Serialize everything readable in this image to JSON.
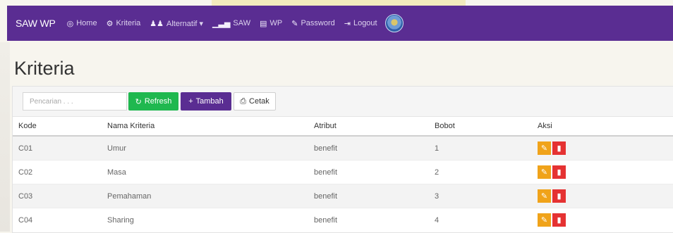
{
  "navbar": {
    "brand": "SAW WP",
    "items": [
      {
        "label": "Home",
        "icon": "dashboard-icon",
        "glyph": "◎"
      },
      {
        "label": "Kriteria",
        "icon": "gear-icon",
        "glyph": "⚙"
      },
      {
        "label": "Alternatif ▾",
        "icon": "users-icon",
        "glyph": "👥"
      },
      {
        "label": "SAW",
        "icon": "signal-icon",
        "glyph": "▁▃▅"
      },
      {
        "label": "WP",
        "icon": "briefcase-icon",
        "glyph": "▤"
      },
      {
        "label": "Password",
        "icon": "pencil-icon",
        "glyph": "✎"
      },
      {
        "label": "Logout",
        "icon": "logout-icon",
        "glyph": "⇥"
      }
    ]
  },
  "page": {
    "title": "Kriteria"
  },
  "toolbar": {
    "search_placeholder": "Pencarian . . .",
    "refresh_label": "Refresh",
    "tambah_label": "Tambah",
    "cetak_label": "Cetak"
  },
  "table": {
    "columns": [
      "Kode",
      "Nama Kriteria",
      "Atribut",
      "Bobot",
      "Aksi"
    ],
    "rows": [
      [
        "C01",
        "Umur",
        "benefit",
        "1"
      ],
      [
        "C02",
        "Masa",
        "benefit",
        "2"
      ],
      [
        "C03",
        "Pemahaman",
        "benefit",
        "3"
      ],
      [
        "C04",
        "Sharing",
        "benefit",
        "4"
      ]
    ]
  },
  "colors": {
    "navbar": "#5a2d92",
    "refresh": "#1fb84f",
    "tambah": "#5a2d92",
    "edit": "#f0a31a",
    "delete": "#e53232"
  }
}
